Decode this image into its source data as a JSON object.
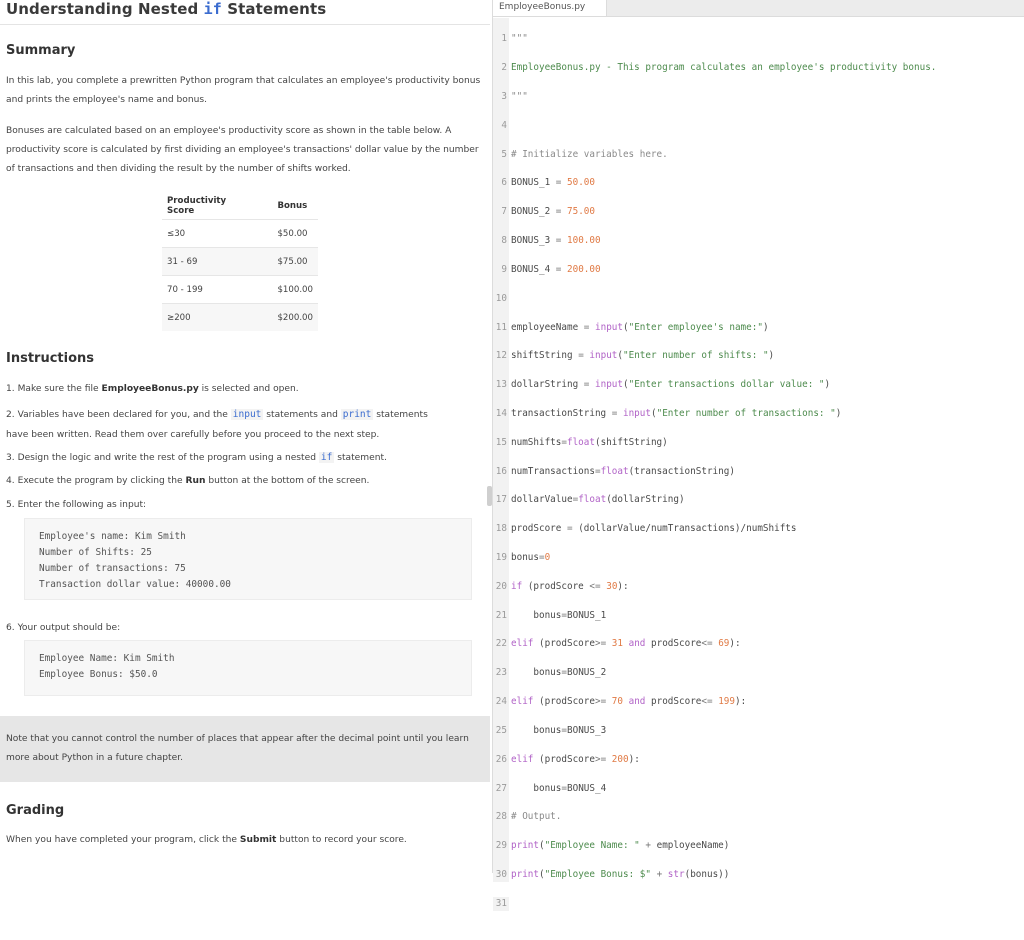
{
  "lesson": {
    "title_pre": "Understanding Nested ",
    "title_kw": "if",
    "title_post": " Statements",
    "summary_heading": "Summary",
    "summary_p1": "In this lab, you complete a prewritten Python program that calculates an employee's productivity bonus and prints the employee's name and bonus.",
    "summary_p2": "Bonuses are calculated based on an employee's productivity score as shown in the table below. A productivity score is calculated by first dividing an employee's transactions' dollar value by the number of transactions and then dividing the result by the number of shifts worked.",
    "table": {
      "headers": [
        "Productivity Score",
        "Bonus"
      ],
      "rows": [
        [
          "≤30",
          "$50.00"
        ],
        [
          "31 - 69",
          "$75.00"
        ],
        [
          "70 - 199",
          "$100.00"
        ],
        [
          "≥200",
          "$200.00"
        ]
      ]
    },
    "instructions_heading": "Instructions",
    "steps": {
      "s1_a": "1. Make sure the file ",
      "s1_b": "EmployeeBonus.py",
      "s1_c": " is selected and open.",
      "s2_a": "2. Variables have been declared for you, and the ",
      "s2_b": "input",
      "s2_c": " statements and ",
      "s2_d": "print",
      "s2_e": " statements",
      "s2_f": "have been written. Read them over carefully before you proceed to the next step.",
      "s3_a": "3. Design the logic and write the rest of the program using a nested ",
      "s3_b": "if",
      "s3_c": " statement.",
      "s4_a": "4. Execute the program by clicking the ",
      "s4_b": "Run",
      "s4_c": " button at the bottom of the screen.",
      "s5": "5. Enter the following as input:",
      "input_block": "Employee's name: Kim Smith\nNumber of Shifts: 25\nNumber of transactions: 75\nTransaction dollar value: 40000.00",
      "s6": "6. Your output should be:",
      "output_block": "Employee Name: Kim Smith\nEmployee Bonus: $50.0"
    },
    "note": "Note that you cannot control the number of places that appear after the decimal point until you learn more about Python in a future chapter.",
    "grading_heading": "Grading",
    "grading_a": "When you have completed your program, click the ",
    "grading_b": "Submit",
    "grading_c": " button to record your score."
  },
  "editor": {
    "tab_label": "EmployeeBonus.py",
    "line_numbers": [
      "1",
      "2",
      "3",
      "4",
      "5",
      "6",
      "7",
      "8",
      "9",
      "10",
      "11",
      "12",
      "13",
      "14",
      "15",
      "16",
      "17",
      "18",
      "19",
      "20",
      "21",
      "22",
      "23",
      "24",
      "25",
      "26",
      "27",
      "28",
      "29",
      "30",
      "31"
    ]
  },
  "colors": {
    "keyword_blue": "#3b6ccf",
    "number_orange": "#e07a45",
    "string_green": "#4d8b4d",
    "builtin_purple": "#b163c7",
    "note_bg": "#e6e6e6"
  }
}
